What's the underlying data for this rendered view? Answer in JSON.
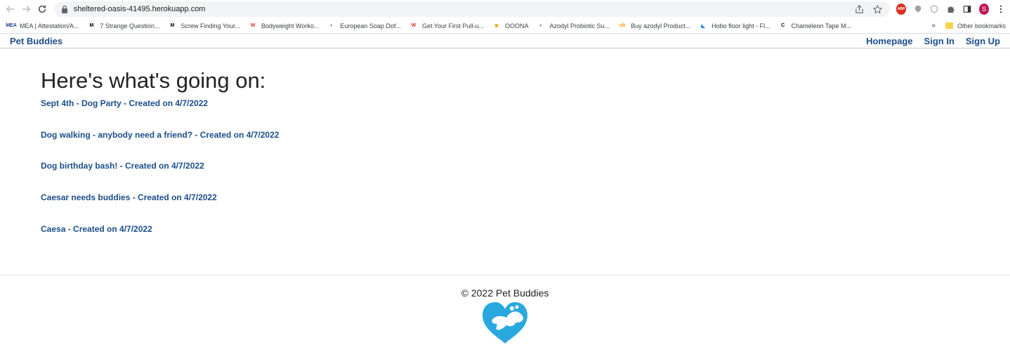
{
  "browser": {
    "url": "sheltered-oasis-41495.herokuapp.com",
    "profile_initial": "S",
    "abp_label": "ABP",
    "bookmarks": [
      {
        "label": "MEA | Attestation/A...",
        "fav": "MEA",
        "fav_color": "#1a3a8a"
      },
      {
        "label": "7 Strange Question...",
        "fav": "M",
        "fav_color": "#000000"
      },
      {
        "label": "Screw Finding Your...",
        "fav": "M",
        "fav_color": "#000000"
      },
      {
        "label": "Bodyweight Worko...",
        "fav": "W",
        "fav_color": "#d93025"
      },
      {
        "label": "European Soap Dof...",
        "fav": "◐",
        "fav_color": "#5f6368"
      },
      {
        "label": "Get Your First Pull-u...",
        "fav": "W",
        "fav_color": "#d93025"
      },
      {
        "label": "OOONA",
        "fav": "✖",
        "fav_color": "#e8a100"
      },
      {
        "label": "Azodyl Probiotic Su...",
        "fav": "◐",
        "fav_color": "#5f6368"
      },
      {
        "label": "Buy azodyl Product...",
        "fav": "ub",
        "fav_color": "#e8a100"
      },
      {
        "label": "Hobo floor light - Fl...",
        "fav": "◣",
        "fav_color": "#1e88e5"
      },
      {
        "label": "Chameleon Tape M...",
        "fav": "C",
        "fav_color": "#000000"
      }
    ],
    "more_label": "»",
    "other_bookmarks": "Other bookmarks"
  },
  "nav": {
    "brand": "Pet Buddies",
    "links": [
      "Homepage",
      "Sign In",
      "Sign Up"
    ]
  },
  "main": {
    "headline": "Here's what's going on:",
    "events": [
      "Sept 4th - Dog Party - Created on 4/7/2022",
      "Dog walking - anybody need a friend? - Created on 4/7/2022",
      "Dog birthday bash! - Created on 4/7/2022",
      "Caesar needs buddies - Created on 4/7/2022",
      "Caesa - Created on 4/7/2022"
    ]
  },
  "footer": {
    "copyright": "© 2022 Pet Buddies"
  },
  "colors": {
    "link": "#1b4e8a",
    "logo": "#29a8e0"
  }
}
